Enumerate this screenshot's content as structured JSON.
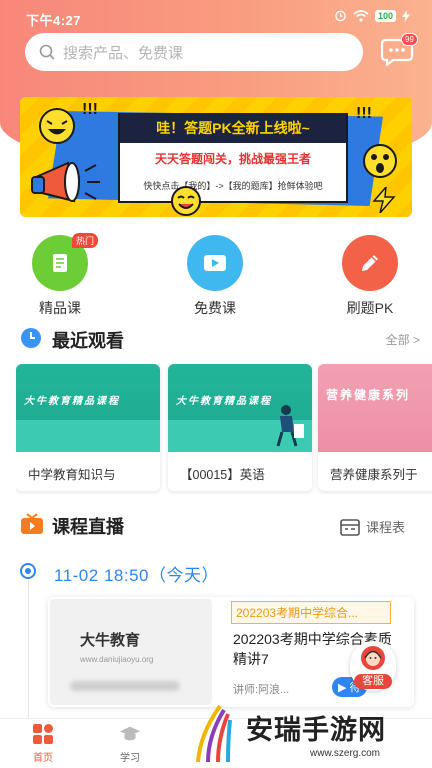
{
  "status_bar": {
    "time": "下午4:27",
    "battery": "100"
  },
  "search": {
    "placeholder": "搜索产品、免费课"
  },
  "messages": {
    "badge": "99"
  },
  "banner": {
    "title": "哇！答题PK全新上线啦~",
    "subtitle": "天天答题闯关，挑战最强王者",
    "hint": "快快点击【我的】->【我的题库】抢鲜体验吧",
    "exclaim": "!!!"
  },
  "quick_entries": [
    {
      "label": "精品课",
      "tag": "热门",
      "color": "#6ccd36",
      "icon": "document-icon"
    },
    {
      "label": "免费课",
      "color": "#3fb8f0",
      "icon": "video-icon"
    },
    {
      "label": "刷题PK",
      "color": "#f26148",
      "icon": "pencil-icon"
    }
  ],
  "recent": {
    "title": "最近观看",
    "more": "全部 >",
    "items": [
      {
        "thumb_text": "大牛教育精品课程",
        "title": "中学教育知识与"
      },
      {
        "thumb_text": "大牛教育精品课程",
        "title": "【00015】英语"
      },
      {
        "thumb_text": "营养健康系列",
        "title": "营养健康系列于"
      }
    ]
  },
  "live": {
    "title": "课程直播",
    "schedule_label": "课程表",
    "date": "11-02   18:50（今天）",
    "card": {
      "logo": "大牛教育",
      "logo_url": "www.daniujiaoyu.org",
      "tag": "202203考期中学综合...",
      "title": "202203考期中学综合素质精讲7",
      "teacher": "讲师:阿浪...",
      "status": "待"
    }
  },
  "customer_service": {
    "label": "客服"
  },
  "tabbar": {
    "items": [
      {
        "label": "首页",
        "active": true
      },
      {
        "label": "学习",
        "active": false
      }
    ]
  },
  "watermark": {
    "text": "安瑞手游网",
    "url": "www.szerg.com"
  },
  "colors": {
    "accent": "#2f86f2",
    "brand": "#f8877a",
    "active_tab": "#f05a3c"
  }
}
